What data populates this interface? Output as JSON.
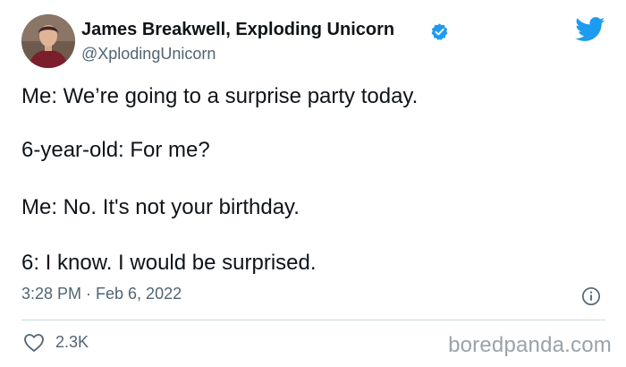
{
  "author": {
    "name": "James Breakwell, Exploding Unicorn",
    "handle": "@XplodingUnicorn",
    "verified_icon": "verified-badge-icon"
  },
  "tweet": {
    "lines": [
      "Me: We’re going to a surprise party today.",
      "6-year-old: For me?",
      "Me: No. It's not your birthday.",
      "6: I know. I would be surprised."
    ],
    "timestamp": "3:28 PM · Feb 6, 2022"
  },
  "actions": {
    "like_icon": "heart-icon",
    "like_count": "2.3K",
    "info_icon": "info-icon"
  },
  "branding": {
    "platform_icon": "twitter-bird-icon",
    "watermark": "boredpanda.com"
  },
  "colors": {
    "accent": "#1d9bf0",
    "text": "#0f1419",
    "secondary_text": "#536471",
    "divider": "#cfd9de",
    "watermark": "#9aa3aa"
  }
}
